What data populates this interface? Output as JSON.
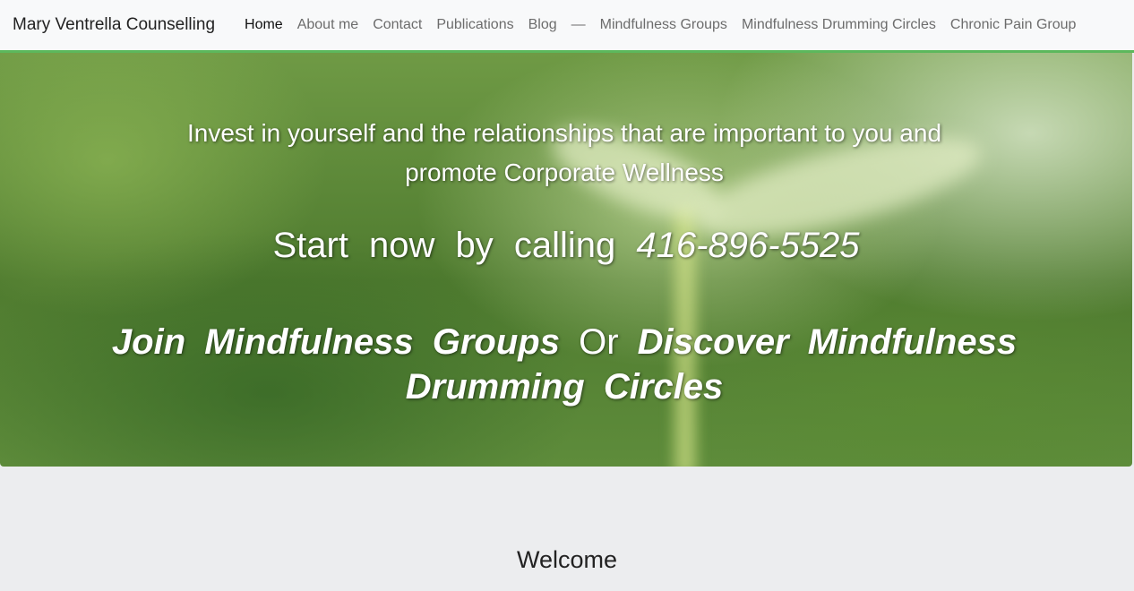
{
  "navbar": {
    "brand": "Mary Ventrella Counselling",
    "items": [
      {
        "label": "Home",
        "active": true
      },
      {
        "label": "About me"
      },
      {
        "label": "Contact"
      },
      {
        "label": "Publications"
      },
      {
        "label": "Blog"
      },
      {
        "label": "—"
      },
      {
        "label": "Mindfulness Groups"
      },
      {
        "label": "Mindfulness Drumming Circles"
      },
      {
        "label": "Chronic Pain Group"
      }
    ],
    "accent_color": "#5cb85c"
  },
  "hero": {
    "tagline": "Invest in yourself and the relationships that are important to you and promote Corporate Wellness",
    "call_prefix": "Start now by calling",
    "phone": "416-896-5525",
    "join_groups": "Join Mindfulness Groups",
    "or": "Or",
    "discover_circles": "Discover Mindfulness Drumming Circles"
  },
  "main": {
    "welcome_title": "Welcome"
  }
}
